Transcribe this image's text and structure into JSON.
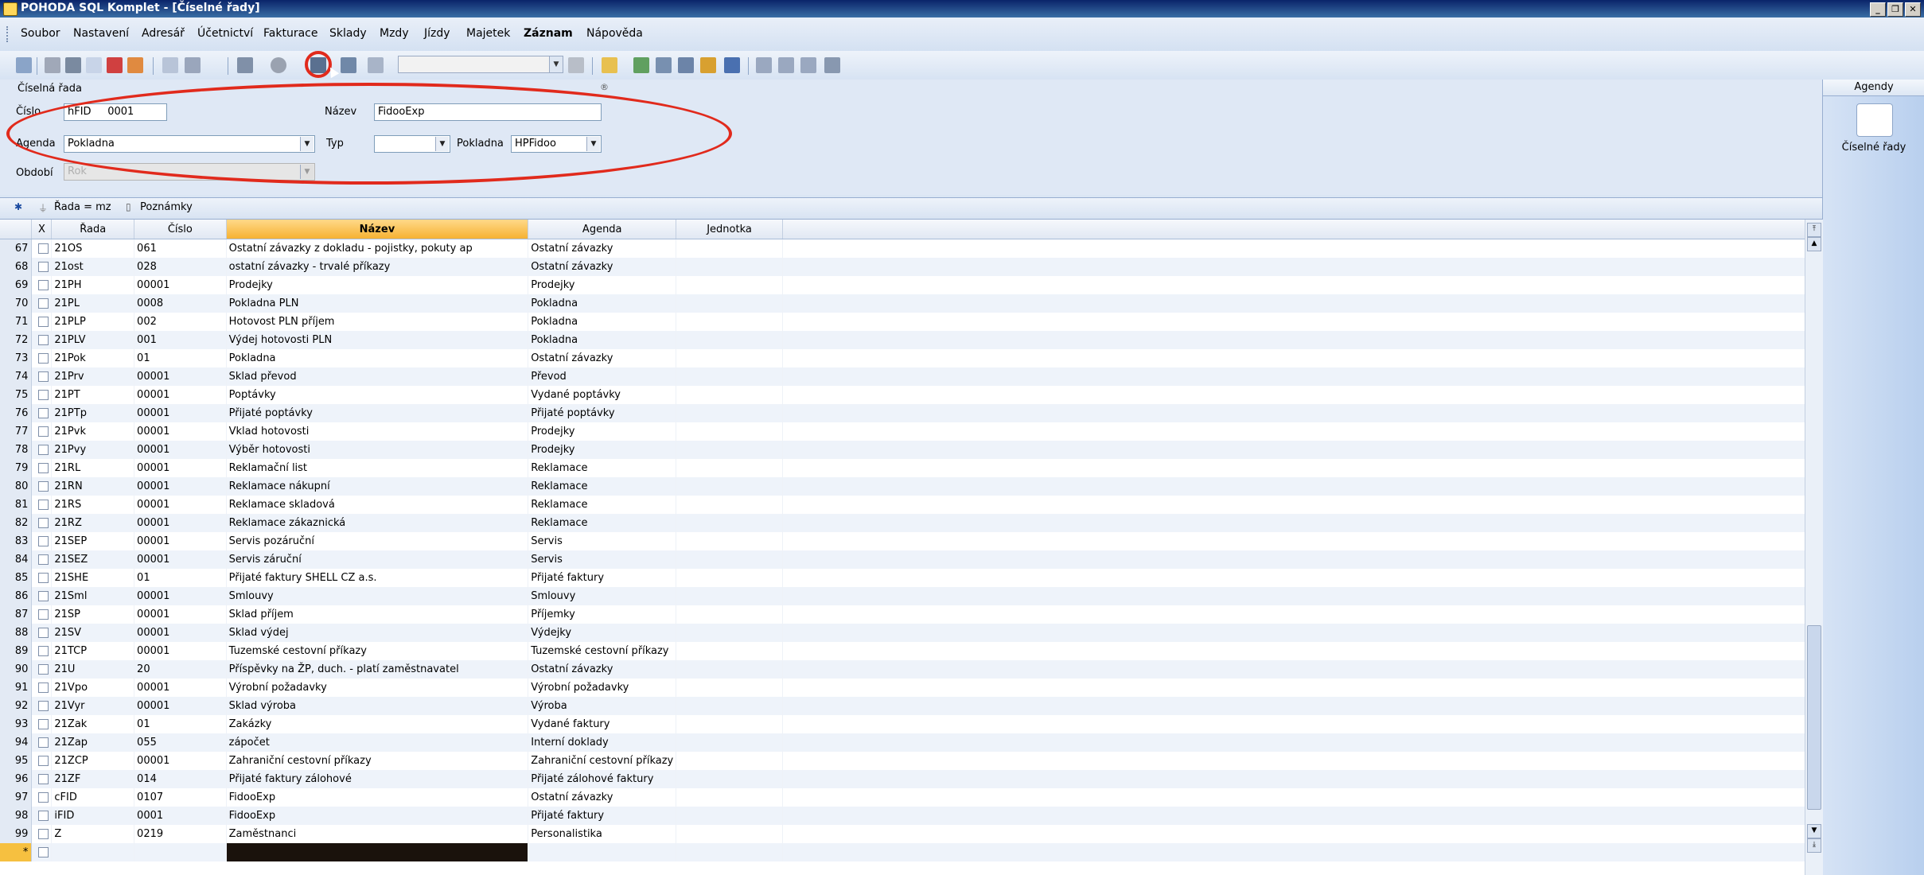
{
  "window": {
    "title": "POHODA SQL Komplet - [Číselné řady]"
  },
  "menu": [
    "Soubor",
    "Nastavení",
    "Adresář",
    "Účetnictví",
    "Fakturace",
    "Sklady",
    "Mzdy",
    "Jízdy",
    "Majetek",
    "Záznam",
    "Nápověda"
  ],
  "form": {
    "section_title": "Číselná řada",
    "cislo_label": "Číslo",
    "cislo_prefix": "hFID",
    "cislo_value": "0001",
    "nazev_label": "Název",
    "nazev_value": "FidooExp",
    "agenda_label": "Agenda",
    "agenda_value": "Pokladna",
    "typ_label": "Typ",
    "typ_value": "",
    "pokladna_label": "Pokladna",
    "pokladna_value": "HPFidoo",
    "obdobi_label": "Období",
    "obdobi_value": "Rok"
  },
  "gridbar": {
    "filter_label": "Řada = mz",
    "notes_label": "Poznámky"
  },
  "agendy": {
    "title": "Agendy",
    "item_label": "Číselné řady"
  },
  "columns": [
    "X",
    "Řada",
    "Číslo",
    "Název",
    "Agenda",
    "Jednotka"
  ],
  "rows": [
    [
      "67",
      "21OS",
      "061",
      "Ostatní závazky z dokladu - pojistky, pokuty ap",
      "Ostatní závazky"
    ],
    [
      "68",
      "21ost",
      "028",
      "ostatní závazky - trvalé příkazy",
      "Ostatní závazky"
    ],
    [
      "69",
      "21PH",
      "00001",
      "Prodejky",
      "Prodejky"
    ],
    [
      "70",
      "21PL",
      "0008",
      "Pokladna PLN",
      "Pokladna"
    ],
    [
      "71",
      "21PLP",
      "002",
      "Hotovost PLN příjem",
      "Pokladna"
    ],
    [
      "72",
      "21PLV",
      "001",
      "Výdej hotovosti PLN",
      "Pokladna"
    ],
    [
      "73",
      "21Pok",
      "01",
      "Pokladna",
      "Ostatní závazky"
    ],
    [
      "74",
      "21Prv",
      "00001",
      "Sklad převod",
      "Převod"
    ],
    [
      "75",
      "21PT",
      "00001",
      "Poptávky",
      "Vydané poptávky"
    ],
    [
      "76",
      "21PTp",
      "00001",
      "Přijaté poptávky",
      "Přijaté poptávky"
    ],
    [
      "77",
      "21Pvk",
      "00001",
      "Vklad hotovosti",
      "Prodejky"
    ],
    [
      "78",
      "21Pvy",
      "00001",
      "Výběr hotovosti",
      "Prodejky"
    ],
    [
      "79",
      "21RL",
      "00001",
      "Reklamační list",
      "Reklamace"
    ],
    [
      "80",
      "21RN",
      "00001",
      "Reklamace nákupní",
      "Reklamace"
    ],
    [
      "81",
      "21RS",
      "00001",
      "Reklamace skladová",
      "Reklamace"
    ],
    [
      "82",
      "21RZ",
      "00001",
      "Reklamace zákaznická",
      "Reklamace"
    ],
    [
      "83",
      "21SEP",
      "00001",
      "Servis pozáruční",
      "Servis"
    ],
    [
      "84",
      "21SEZ",
      "00001",
      "Servis záruční",
      "Servis"
    ],
    [
      "85",
      "21SHE",
      "01",
      "Přijaté faktury SHELL CZ a.s.",
      "Přijaté faktury"
    ],
    [
      "86",
      "21Sml",
      "00001",
      "Smlouvy",
      "Smlouvy"
    ],
    [
      "87",
      "21SP",
      "00001",
      "Sklad příjem",
      "Příjemky"
    ],
    [
      "88",
      "21SV",
      "00001",
      "Sklad výdej",
      "Výdejky"
    ],
    [
      "89",
      "21TCP",
      "00001",
      "Tuzemské cestovní příkazy",
      "Tuzemské cestovní příkazy"
    ],
    [
      "90",
      "21U",
      "20",
      "Příspěvky na ŽP, duch. - platí zaměstnavatel",
      "Ostatní závazky"
    ],
    [
      "91",
      "21Vpo",
      "00001",
      "Výrobní požadavky",
      "Výrobní požadavky"
    ],
    [
      "92",
      "21Vyr",
      "00001",
      "Sklad výroba",
      "Výroba"
    ],
    [
      "93",
      "21Zak",
      "01",
      "Zakázky",
      "Vydané faktury"
    ],
    [
      "94",
      "21Zap",
      "055",
      "zápočet",
      "Interní doklady"
    ],
    [
      "95",
      "21ZCP",
      "00001",
      "Zahraniční cestovní příkazy",
      "Zahraniční cestovní příkazy"
    ],
    [
      "96",
      "21ZF",
      "014",
      "Přijaté faktury zálohové",
      "Přijaté zálohové faktury"
    ],
    [
      "97",
      "cFID",
      "0107",
      "FidooExp",
      "Ostatní závazky"
    ],
    [
      "98",
      "iFID",
      "0001",
      "FidooExp",
      "Přijaté faktury"
    ],
    [
      "99",
      "Z",
      "0219",
      "Zaměstnanci",
      "Personalistika"
    ]
  ],
  "new_row_marker": "*"
}
